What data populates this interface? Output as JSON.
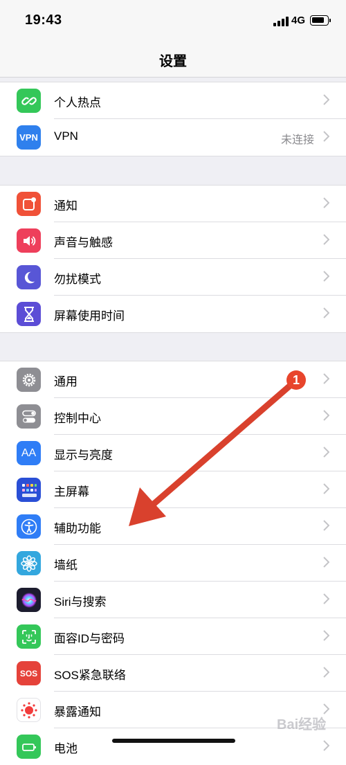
{
  "status_bar": {
    "time": "19:43",
    "network": "4G"
  },
  "nav": {
    "title": "设置"
  },
  "groups": [
    {
      "items": [
        {
          "label": "个人热点",
          "icon": "link-icon",
          "color": "#34c759"
        },
        {
          "label": "VPN",
          "value": "未连接",
          "icon": "vpn-icon",
          "icon_text": "VPN",
          "color": "#2f80ed"
        }
      ]
    },
    {
      "items": [
        {
          "label": "通知",
          "icon": "notification-icon",
          "color": "#f05138"
        },
        {
          "label": "声音与触感",
          "icon": "speaker-icon",
          "color": "#ee3f5b"
        },
        {
          "label": "勿扰模式",
          "icon": "moon-icon",
          "color": "#5856d6"
        },
        {
          "label": "屏幕使用时间",
          "icon": "hourglass-icon",
          "color": "#5c4dd6"
        }
      ]
    },
    {
      "items": [
        {
          "label": "通用",
          "icon": "gear-icon",
          "color": "#8e8e93"
        },
        {
          "label": "控制中心",
          "icon": "toggles-icon",
          "color": "#8e8e93"
        },
        {
          "label": "显示与亮度",
          "icon": "text-size-icon",
          "icon_text": "AA",
          "color": "#2f7df6"
        },
        {
          "label": "主屏幕",
          "icon": "home-grid-icon",
          "color": "#2a4fd6"
        },
        {
          "label": "辅助功能",
          "icon": "accessibility-icon",
          "color": "#2f7df6"
        },
        {
          "label": "墙纸",
          "icon": "flower-icon",
          "color": "#33a7de"
        },
        {
          "label": "Siri与搜索",
          "icon": "siri-icon",
          "color": "#1c1c2e"
        },
        {
          "label": "面容ID与密码",
          "icon": "face-id-icon",
          "color": "#34c759"
        },
        {
          "label": "SOS紧急联络",
          "icon": "sos-icon",
          "icon_text": "SOS",
          "color": "#e5423a"
        },
        {
          "label": "暴露通知",
          "icon": "exposure-icon",
          "color": "#ffffff"
        },
        {
          "label": "电池",
          "icon": "battery-icon",
          "color": "#34c759"
        }
      ]
    }
  ],
  "annotation": {
    "badge": "1",
    "arrow_color": "#d9412d"
  },
  "watermark": "Bai经验"
}
